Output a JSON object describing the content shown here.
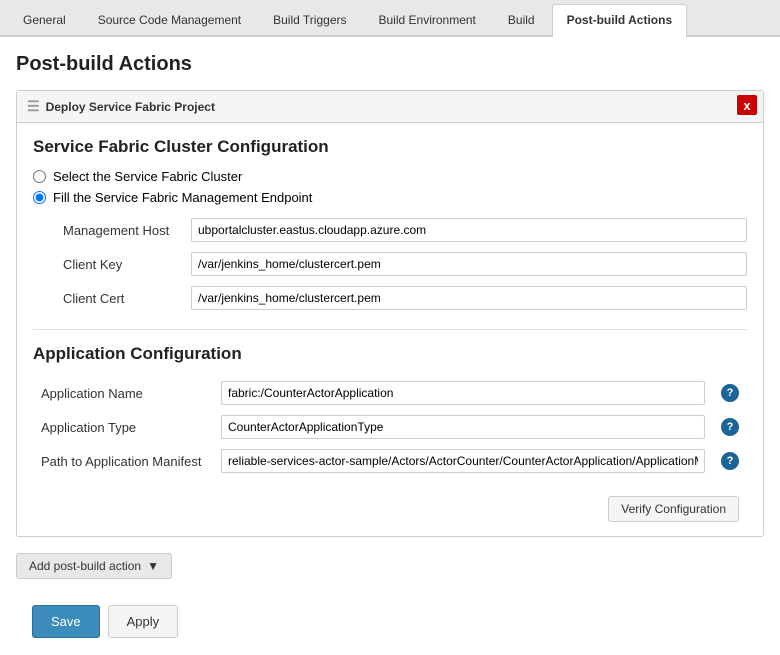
{
  "tabs": [
    {
      "label": "General",
      "active": false
    },
    {
      "label": "Source Code Management",
      "active": false
    },
    {
      "label": "Build Triggers",
      "active": false
    },
    {
      "label": "Build Environment",
      "active": false
    },
    {
      "label": "Build",
      "active": false
    },
    {
      "label": "Post-build Actions",
      "active": true
    }
  ],
  "page": {
    "title": "Post-build Actions"
  },
  "panel": {
    "header": "Deploy Service Fabric Project",
    "close_label": "x",
    "cluster_config": {
      "section_title": "Service Fabric Cluster Configuration",
      "radio1_label": "Select the Service Fabric Cluster",
      "radio2_label": "Fill the Service Fabric Management Endpoint",
      "fields": [
        {
          "label": "Management Host",
          "value": "ubportalcluster.eastus.cloudapp.azure.com"
        },
        {
          "label": "Client Key",
          "value": "/var/jenkins_home/clustercert.pem"
        },
        {
          "label": "Client Cert",
          "value": "/var/jenkins_home/clustercert.pem"
        }
      ]
    },
    "app_config": {
      "section_title": "Application Configuration",
      "fields": [
        {
          "label": "Application Name",
          "value": "fabric:/CounterActorApplication",
          "help": true
        },
        {
          "label": "Application Type",
          "value": "CounterActorApplicationType",
          "help": true
        },
        {
          "label": "Path to Application Manifest",
          "value": "reliable-services-actor-sample/Actors/ActorCounter/CounterActorApplication/ApplicationManifes",
          "help": true
        }
      ],
      "verify_btn_label": "Verify Configuration"
    }
  },
  "add_action_btn": "Add post-build action",
  "buttons": {
    "save": "Save",
    "apply": "Apply"
  }
}
